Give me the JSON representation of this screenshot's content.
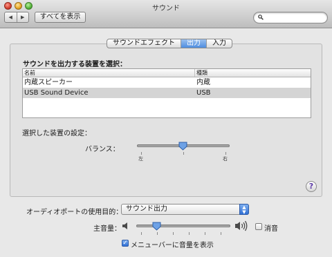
{
  "window": {
    "title": "サウンド"
  },
  "toolbar": {
    "back_label": "◀",
    "forward_label": "▶",
    "show_all_label": "すべてを表示",
    "search_placeholder": ""
  },
  "tabs": [
    {
      "label": "サウンドエフェクト",
      "selected": false
    },
    {
      "label": "出力",
      "selected": true
    },
    {
      "label": "入力",
      "selected": false
    }
  ],
  "output": {
    "section_label": "サウンドを出力する装置を選択：",
    "columns": {
      "name": "名前",
      "type": "種類"
    },
    "devices": [
      {
        "name": "内蔵スピーカー",
        "type": "内蔵",
        "selected": false
      },
      {
        "name": "USB Sound Device",
        "type": "USB",
        "selected": true
      }
    ],
    "settings_label": "選択した装置の設定：",
    "balance": {
      "label": "バランス：",
      "left_label": "左",
      "right_label": "右",
      "value": 0.5
    }
  },
  "help_label": "?",
  "bottom": {
    "port_label": "オーディオポートの使用目的：",
    "port_value": "サウンド出力",
    "volume_label": "主音量：",
    "volume_value": 0.22,
    "mute_label": "消音",
    "mute_checked": false,
    "menubar_label": "メニューバーに音量を表示",
    "menubar_checked": true
  },
  "colors": {
    "accent": "#4f8ee0",
    "selected_row": "#d4d4d4"
  }
}
